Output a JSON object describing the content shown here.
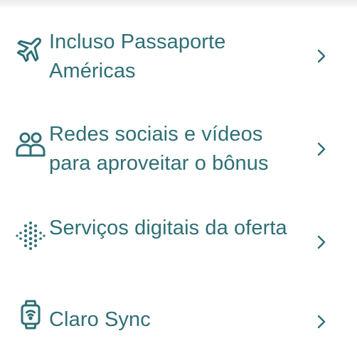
{
  "items": [
    {
      "label": "Incluso Passaporte Américas",
      "icon": "airplane-icon"
    },
    {
      "label": "Redes sociais e vídeos para aproveitar o bônus",
      "icon": "users-icon"
    },
    {
      "label": "Serviços digitais da oferta",
      "icon": "dots-burst-icon"
    },
    {
      "label": "Claro Sync",
      "icon": "smartwatch-icon"
    }
  ],
  "colors": {
    "text": "#2e6f76",
    "icon": "#2e6f76",
    "chevron": "#2e6f76",
    "background": "#ffffff"
  }
}
